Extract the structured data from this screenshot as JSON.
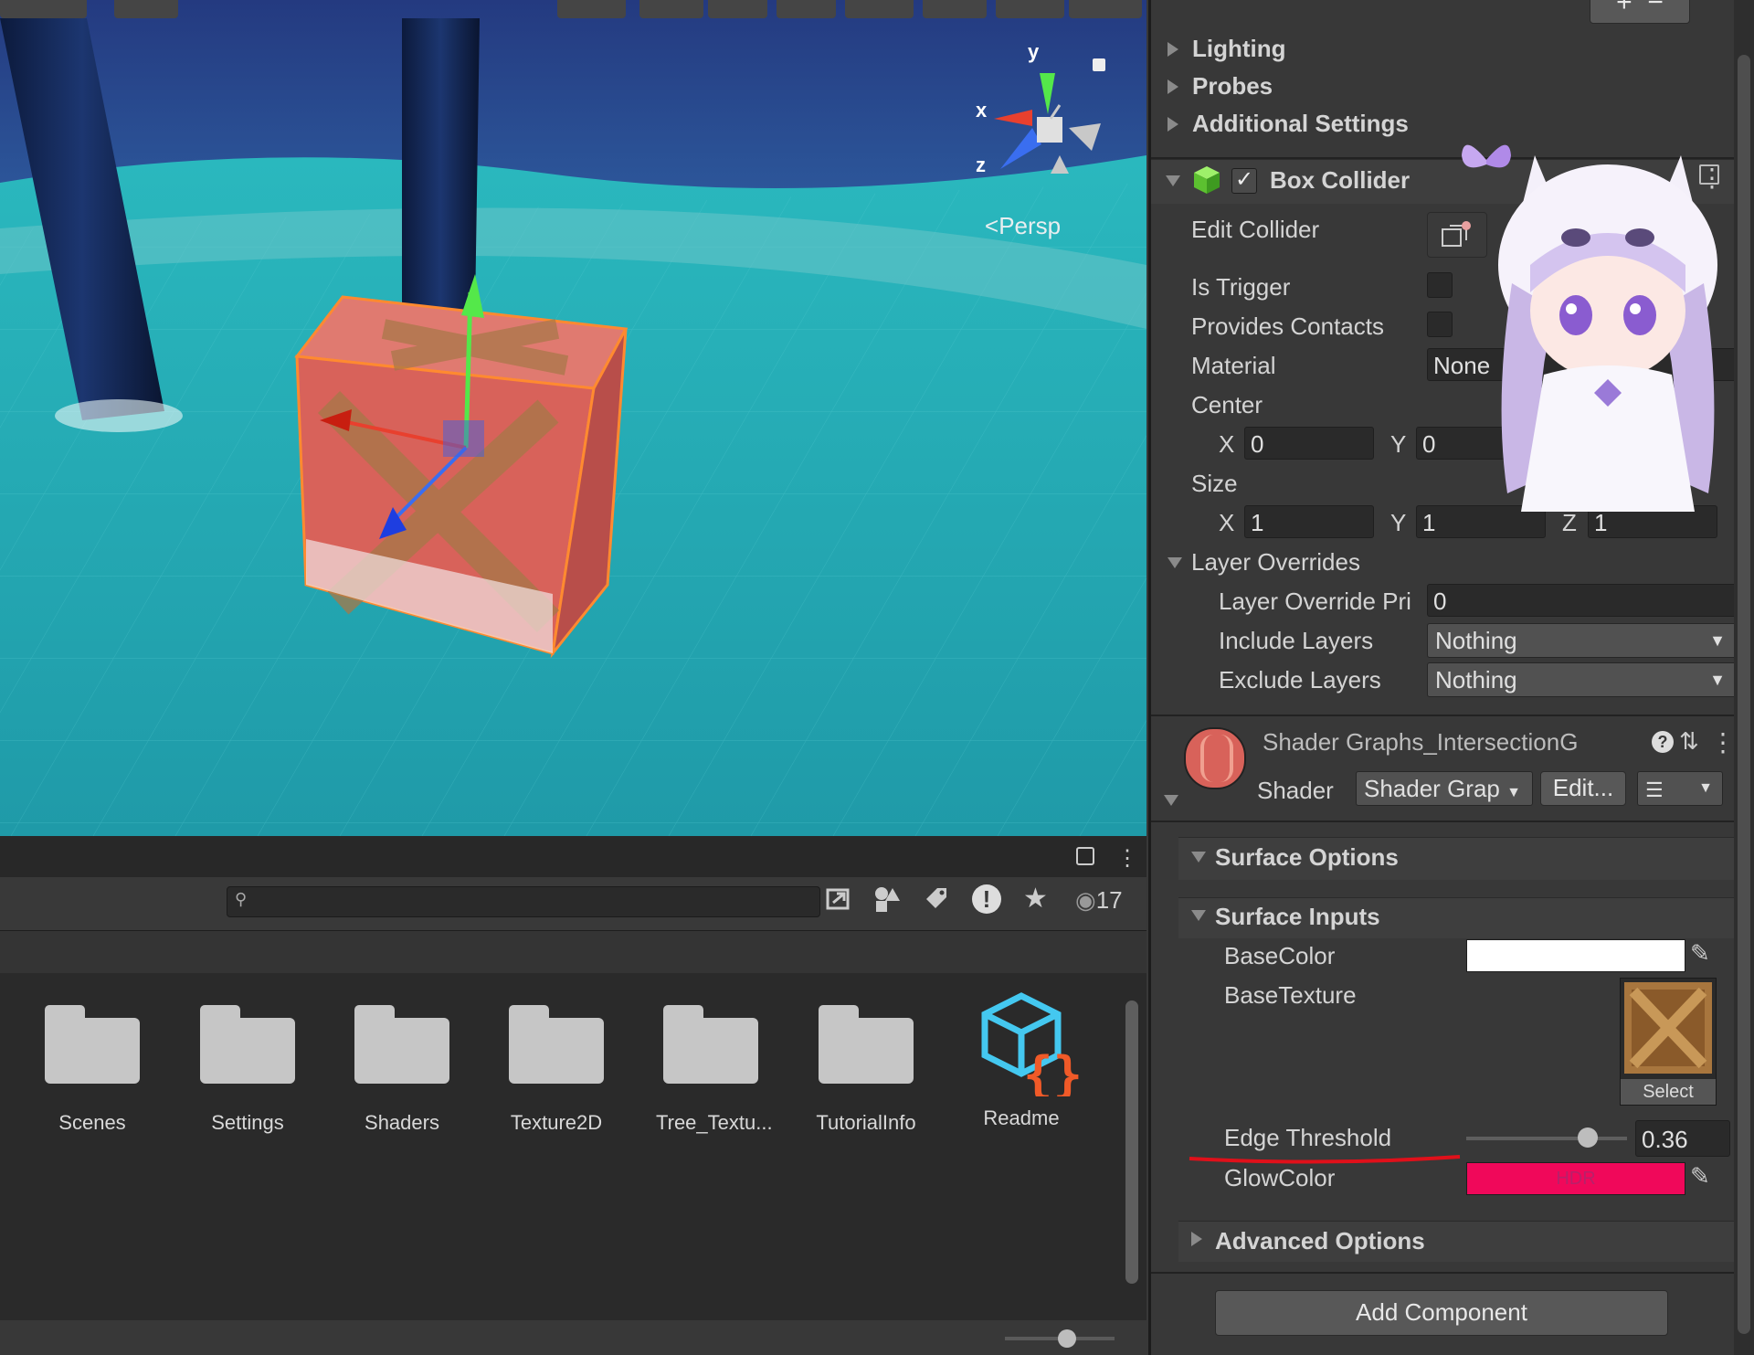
{
  "scene": {
    "view_mode": "Persp",
    "gizmo_axes": {
      "y": "y",
      "x": "x",
      "z": "z"
    },
    "colors": {
      "water": "#24b0b8",
      "sky": "#2a3f86",
      "crate": "#d8625a",
      "selection": "#ff8a30"
    }
  },
  "project": {
    "search": {
      "placeholder": ""
    },
    "hidden_count": "17",
    "items": [
      {
        "label": "Scenes",
        "icon": "folder-icon"
      },
      {
        "label": "Settings",
        "icon": "folder-icon"
      },
      {
        "label": "Shaders",
        "icon": "folder-icon"
      },
      {
        "label": "Texture2D",
        "icon": "folder-icon"
      },
      {
        "label": "Tree_Textu...",
        "icon": "folder-icon"
      },
      {
        "label": "TutorialInfo",
        "icon": "folder-icon"
      },
      {
        "label": "Readme",
        "icon": "readme-asset-icon"
      }
    ]
  },
  "inspector": {
    "collapsed_sections": [
      "Lighting",
      "Probes",
      "Additional Settings"
    ],
    "box_collider": {
      "title": "Box Collider",
      "enabled": true,
      "edit_collider_label": "Edit Collider",
      "is_trigger_label": "Is Trigger",
      "provides_contacts_label": "Provides Contacts",
      "material_label": "Material",
      "material_value": "None",
      "center_label": "Center",
      "center": {
        "x": "0",
        "y": "0"
      },
      "size_label": "Size",
      "size": {
        "x": "1",
        "y": "1",
        "z": "1"
      },
      "axis_labels": {
        "x": "X",
        "y": "Y",
        "z": "Z"
      },
      "layer_overrides_label": "Layer Overrides",
      "layer_override_priority_label": "Layer Override Pri",
      "layer_override_priority_value": "0",
      "include_layers_label": "Include Layers",
      "include_layers_value": "Nothing",
      "exclude_layers_label": "Exclude Layers",
      "exclude_layers_value": "Nothing"
    },
    "material": {
      "name": "Shader Graphs_IntersectionG",
      "shader_label": "Shader",
      "shader_value": "Shader Grap",
      "edit_label": "Edit..."
    },
    "surface_options_label": "Surface Options",
    "surface_inputs_label": "Surface Inputs",
    "base_color_label": "BaseColor",
    "base_color_value": "#ffffff",
    "base_texture_label": "BaseTexture",
    "texture_select_label": "Select",
    "edge_threshold_label": "Edge Threshold",
    "edge_threshold_value": "0.36",
    "edge_threshold_fraction": 0.36,
    "glow_color_label": "GlowColor",
    "glow_color_value": "#f0085a",
    "glow_hdr_label": "HDR",
    "advanced_options_label": "Advanced Options",
    "add_component_label": "Add Component",
    "annotation_color": "#e0101a"
  }
}
